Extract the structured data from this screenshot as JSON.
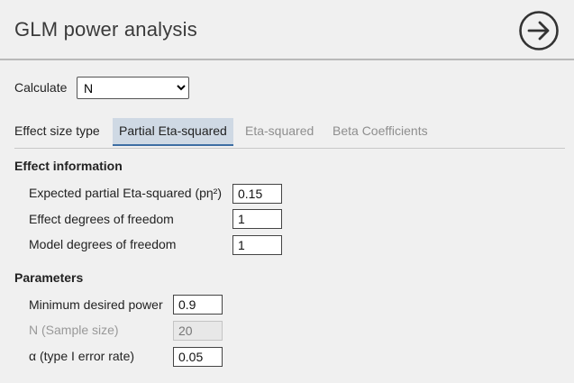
{
  "header": {
    "title": "GLM power analysis",
    "nav_icon": "arrow-right-circle-icon"
  },
  "calculate": {
    "label": "Calculate",
    "selected": "N",
    "options": [
      "N"
    ]
  },
  "tabs": {
    "label": "Effect size type",
    "items": [
      {
        "label": "Partial Eta-squared",
        "active": true
      },
      {
        "label": "Eta-squared",
        "active": false
      },
      {
        "label": "Beta Coefficients",
        "active": false
      }
    ]
  },
  "effect_information": {
    "heading": "Effect information",
    "fields": [
      {
        "label": "Expected partial Eta-squared (pη²)",
        "value": "0.15"
      },
      {
        "label": "Effect degrees of freedom",
        "value": "1"
      },
      {
        "label": "Model degrees of freedom",
        "value": "1"
      }
    ]
  },
  "parameters": {
    "heading": "Parameters",
    "fields": [
      {
        "label": "Minimum desired power",
        "value": "0.9",
        "disabled": false
      },
      {
        "label": "N (Sample size)",
        "value": "20",
        "disabled": true
      },
      {
        "label": "α (type I error rate)",
        "value": "0.05",
        "disabled": false
      }
    ]
  },
  "colors": {
    "active_tab_bg": "#cfd9e4",
    "active_tab_underline": "#3e6ea3",
    "inactive_tab_text": "#8e8e8e"
  }
}
